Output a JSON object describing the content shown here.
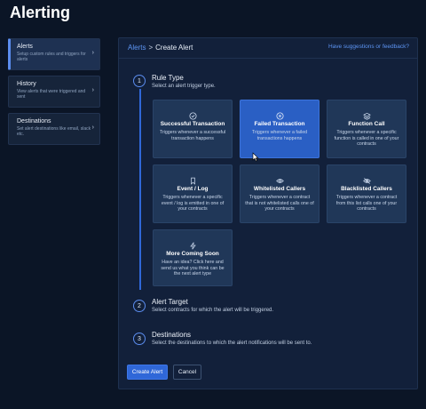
{
  "page": {
    "title": "Alerting"
  },
  "sidebar": {
    "items": [
      {
        "label": "Alerts",
        "desc": "Setup custom rules and triggers for alerts"
      },
      {
        "label": "History",
        "desc": "View alerts that were triggered and sent"
      },
      {
        "label": "Destinations",
        "desc": "Set alert destinations like email, slack etc."
      }
    ]
  },
  "header": {
    "breadcrumb_root": "Alerts",
    "breadcrumb_sep": ">",
    "breadcrumb_current": "Create Alert",
    "feedback_link": "Have suggestions or feedback?"
  },
  "steps": [
    {
      "num": "1",
      "title": "Rule Type",
      "sub": "Select an alert trigger type."
    },
    {
      "num": "2",
      "title": "Alert Target",
      "sub": "Select contracts for which the alert will be triggered."
    },
    {
      "num": "3",
      "title": "Destinations",
      "sub": "Select the destinations to which the alert notifications will be sent to."
    }
  ],
  "cards": [
    {
      "title": "Successful Transaction",
      "desc": "Triggers whenever a successful transaction happens",
      "icon": "check-circle-icon"
    },
    {
      "title": "Failed Transaction",
      "desc": "Triggers whenever a failed transactions happens",
      "icon": "x-circle-icon"
    },
    {
      "title": "Function Call",
      "desc": "Triggers whenever a specific function is called in one of your contracts",
      "icon": "layers-icon"
    },
    {
      "title": "Event / Log",
      "desc": "Triggers whenever a specific event / log is emitted in one of your contracts",
      "icon": "bookmark-icon"
    },
    {
      "title": "Whitelisted Callers",
      "desc": "Triggers whenever a contract that is not whitelisted calls one of your contracts",
      "icon": "eye-icon"
    },
    {
      "title": "Blacklisted Callers",
      "desc": "Triggers whenever a contract from this list calls one of your contracts",
      "icon": "eye-off-icon"
    },
    {
      "title": "More Coming Soon",
      "desc": "Have an idea? Click here and send us what you think can be the next alert type",
      "icon": "zap-icon"
    }
  ],
  "actions": {
    "create": "Create Alert",
    "cancel": "Cancel"
  },
  "colors": {
    "accent": "#2f67d8",
    "selected_card": "#2a5fc4",
    "background": "#0b1526"
  }
}
